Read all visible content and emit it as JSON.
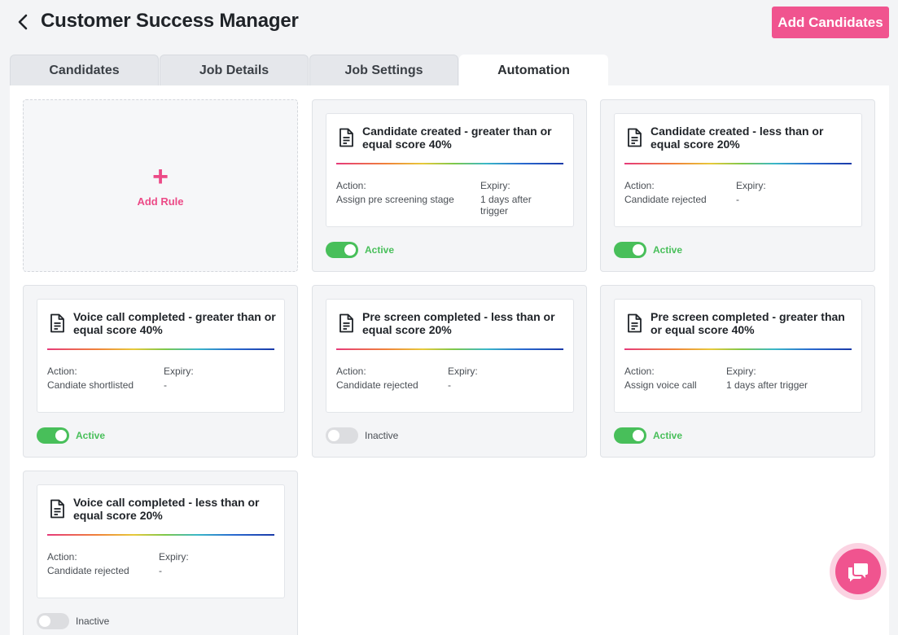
{
  "header": {
    "title": "Customer Success Manager",
    "add_candidates_label": "Add Candidates",
    "back_icon": "chevron-left-icon"
  },
  "tabs": [
    {
      "label": "Candidates",
      "active": false
    },
    {
      "label": "Job Details",
      "active": false
    },
    {
      "label": "Job Settings",
      "active": false
    },
    {
      "label": "Automation",
      "active": true
    }
  ],
  "add_rule": {
    "label": "Add Rule",
    "icon": "plus-icon"
  },
  "labels": {
    "action": "Action:",
    "expiry": "Expiry:"
  },
  "rules": [
    {
      "title": "Candidate created - greater than or equal score 40%",
      "action": "Assign pre screening stage",
      "expiry": "1 days after trigger",
      "status": "Active",
      "enabled": true
    },
    {
      "title": "Candidate created - less than or equal score 20%",
      "action": "Candidate rejected",
      "expiry": "-",
      "status": "Active",
      "enabled": true
    },
    {
      "title": "Voice call completed - greater than or equal score 40%",
      "action": "Candiate shortlisted",
      "expiry": "-",
      "status": "Active",
      "enabled": true
    },
    {
      "title": "Pre screen completed - less than or equal score 20%",
      "action": "Candidate rejected",
      "expiry": "-",
      "status": "Inactive",
      "enabled": false
    },
    {
      "title": "Pre screen completed - greater than or equal score 40%",
      "action": "Assign voice call",
      "expiry": "1 days after trigger",
      "status": "Active",
      "enabled": true
    },
    {
      "title": "Voice call completed - less than or equal score 20%",
      "action": "Candidate rejected",
      "expiry": "-",
      "status": "Inactive",
      "enabled": false
    }
  ],
  "colors": {
    "brand_pink": "#f0548f",
    "active_green": "#48bf5a",
    "inactive_gray": "#dcdde0"
  },
  "chat": {
    "icon": "chat-bubbles-icon"
  }
}
